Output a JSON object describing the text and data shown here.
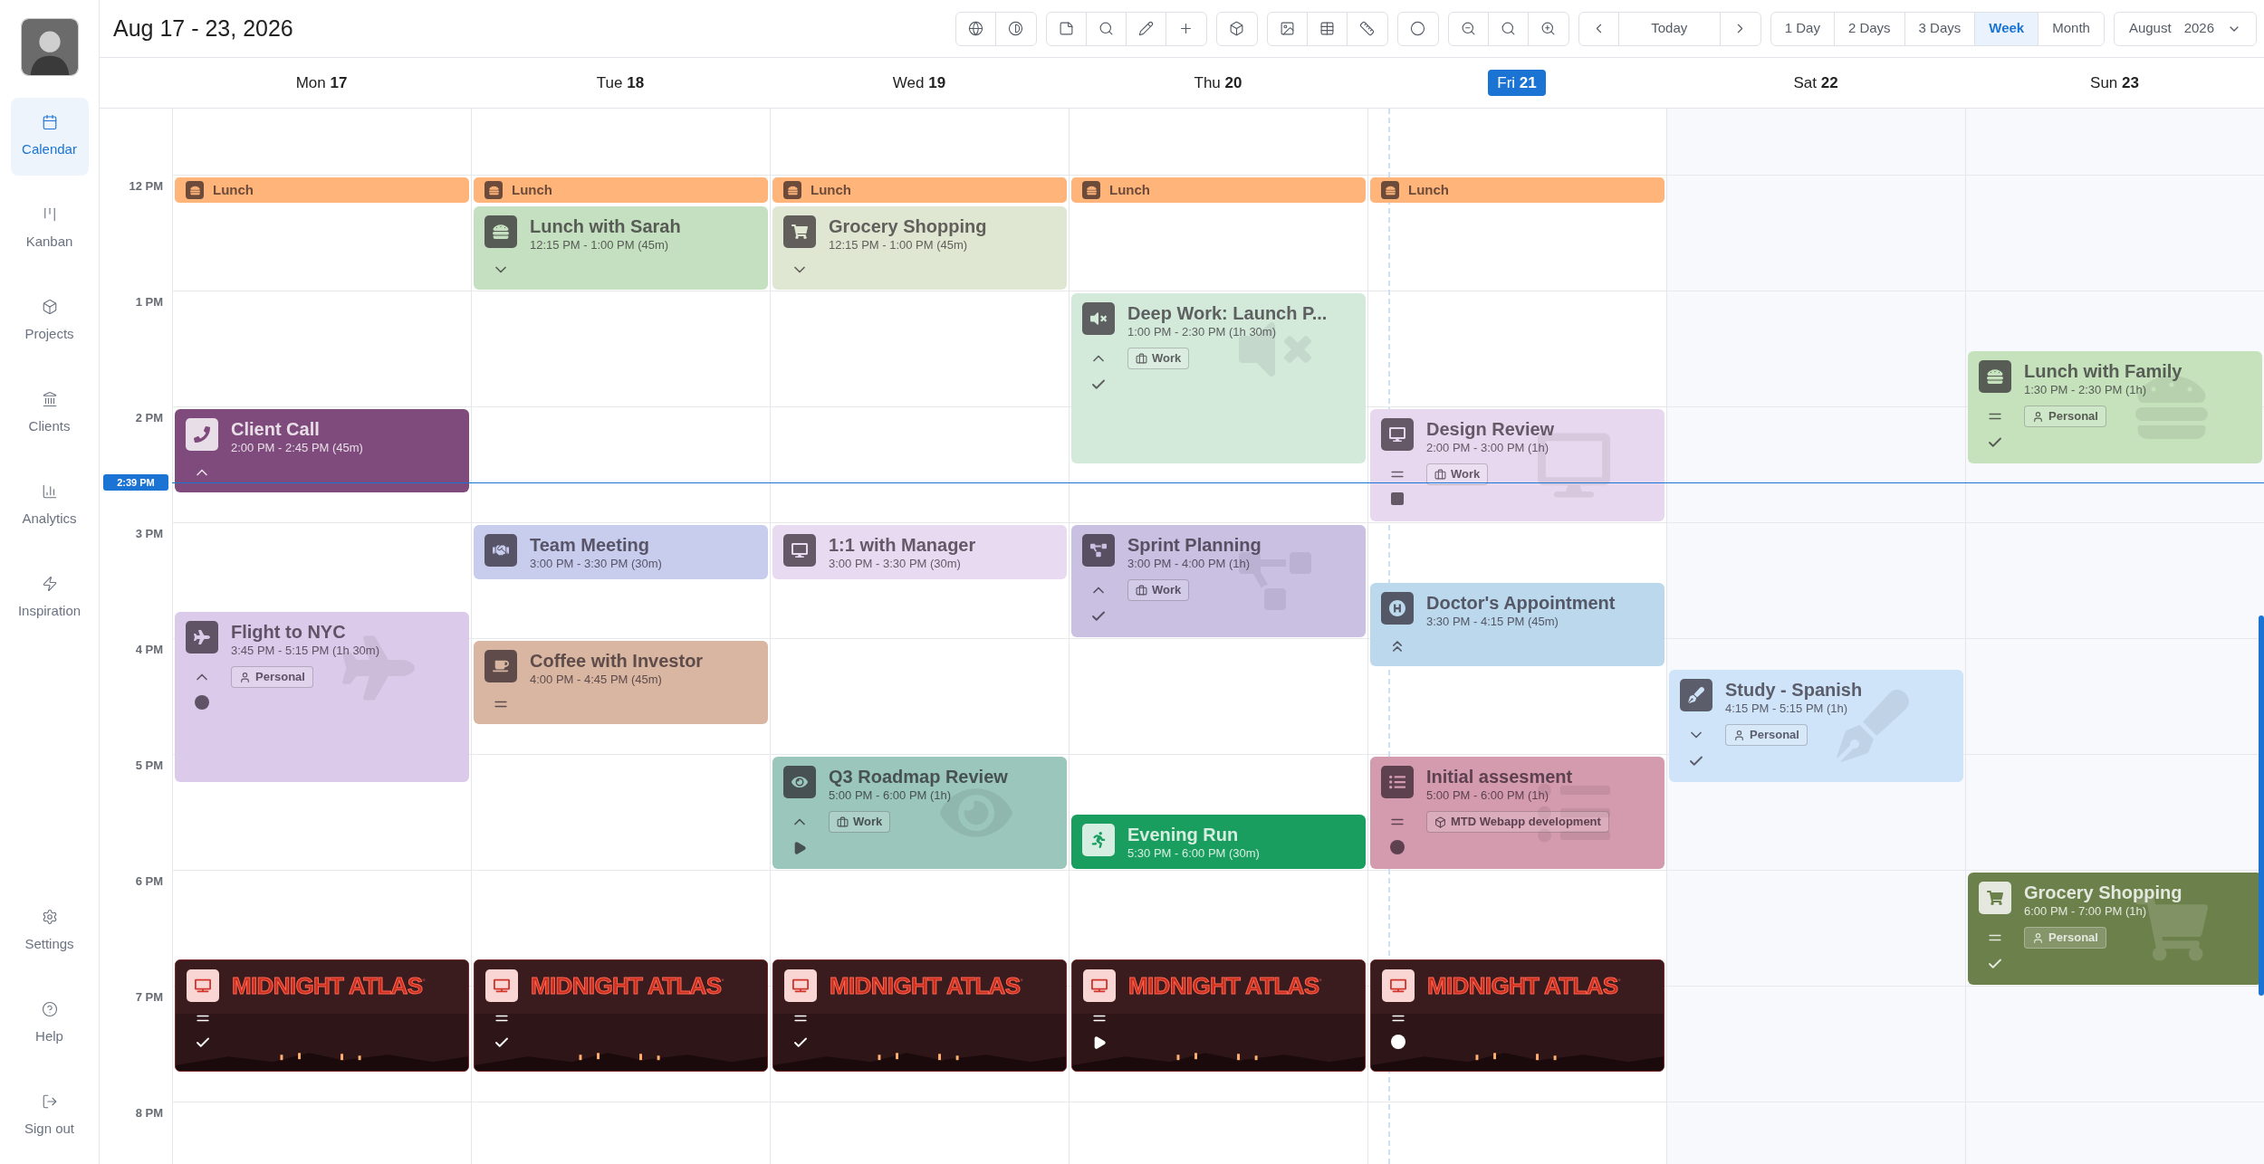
{
  "header": {
    "title": "Aug 17 - 23, 2026"
  },
  "toolbar": {
    "today": "Today",
    "views": [
      {
        "label": "1 Day",
        "selected": false
      },
      {
        "label": "2 Days",
        "selected": false
      },
      {
        "label": "3 Days",
        "selected": false
      },
      {
        "label": "Week",
        "selected": true
      },
      {
        "label": "Month",
        "selected": false
      }
    ],
    "month": "August",
    "year": "2026"
  },
  "sidebar": {
    "items": [
      {
        "label": "Calendar",
        "selected": true
      },
      {
        "label": "Kanban",
        "selected": false
      },
      {
        "label": "Projects",
        "selected": false
      },
      {
        "label": "Clients",
        "selected": false
      },
      {
        "label": "Analytics",
        "selected": false
      },
      {
        "label": "Inspiration",
        "selected": false
      }
    ],
    "bottom_items": [
      {
        "label": "Settings"
      },
      {
        "label": "Help"
      },
      {
        "label": "Sign out"
      }
    ]
  },
  "times": [
    "12 PM",
    "1 PM",
    "2 PM",
    "3 PM",
    "4 PM",
    "5 PM",
    "6 PM",
    "7 PM",
    "8 PM"
  ],
  "now": {
    "label": "2:39 PM"
  },
  "days": [
    {
      "weekday": "Mon",
      "date": "17",
      "today": false,
      "weekend": false,
      "events": [
        {
          "kind": "compact",
          "title": "Lunch",
          "color": "#ffb57a"
        },
        {
          "kind": "card",
          "title": "Client Call",
          "time": "2:00 PM - 2:45 PM (45m)",
          "color": "#7f4a7c",
          "priority": {
            "kind": "high"
          }
        },
        {
          "kind": "card",
          "title": "Flight to NYC",
          "time": "3:45 PM - 5:15 PM (1h 30m)",
          "color": "#dccaea",
          "priority": {
            "kind": "high"
          },
          "tag": {
            "kind": "personal",
            "label": "Personal"
          },
          "status": {
            "kind": "scheduled"
          }
        },
        {
          "kind": "banner",
          "title": "MIDNIGHT ATLAS",
          "color": "#3a1a1c",
          "priority": {
            "kind": "medium"
          },
          "status": {
            "kind": "done"
          }
        }
      ]
    },
    {
      "weekday": "Tue",
      "date": "18",
      "today": false,
      "weekend": false,
      "events": [
        {
          "kind": "compact",
          "title": "Lunch",
          "color": "#ffb57a"
        },
        {
          "kind": "card",
          "title": "Lunch with Sarah",
          "time": "12:15 PM - 1:00 PM (45m)",
          "color": "#c5e0c0",
          "priority": {
            "kind": "low"
          }
        },
        {
          "kind": "card",
          "title": "Team Meeting",
          "time": "3:00 PM - 3:30 PM (30m)",
          "color": "#c8cdee"
        },
        {
          "kind": "card",
          "title": "Coffee with Investor",
          "time": "4:00 PM - 4:45 PM (45m)",
          "color": "#d8b6a2",
          "priority": {
            "kind": "medium"
          }
        },
        {
          "kind": "banner",
          "title": "MIDNIGHT ATLAS",
          "color": "#3a1a1c",
          "priority": {
            "kind": "medium"
          },
          "status": {
            "kind": "done"
          }
        }
      ]
    },
    {
      "weekday": "Wed",
      "date": "19",
      "today": false,
      "weekend": false,
      "events": [
        {
          "kind": "compact",
          "title": "Lunch",
          "color": "#ffb57a"
        },
        {
          "kind": "card",
          "title": "Grocery Shopping",
          "time": "12:15 PM - 1:00 PM (45m)",
          "color": "#dfe7d2",
          "priority": {
            "kind": "low"
          }
        },
        {
          "kind": "card",
          "title": "1:1 with Manager",
          "time": "3:00 PM - 3:30 PM (30m)",
          "color": "#e8daf0"
        },
        {
          "kind": "card",
          "title": "Q3 Roadmap Review",
          "time": "5:00 PM - 6:00 PM (1h)",
          "color": "#9bc6bb",
          "priority": {
            "kind": "high"
          },
          "tag": {
            "kind": "work",
            "label": "Work"
          },
          "status": {
            "kind": "running"
          }
        },
        {
          "kind": "banner",
          "title": "MIDNIGHT ATLAS",
          "color": "#3a1a1c",
          "priority": {
            "kind": "medium"
          },
          "status": {
            "kind": "done"
          }
        }
      ]
    },
    {
      "weekday": "Thu",
      "date": "20",
      "today": false,
      "weekend": false,
      "events": [
        {
          "kind": "compact",
          "title": "Lunch",
          "color": "#ffb57a"
        },
        {
          "kind": "card",
          "title": "Deep Work: Launch P...",
          "time": "1:00 PM - 2:30 PM (1h 30m)",
          "color": "#d3eadb",
          "priority": {
            "kind": "high"
          },
          "tag": {
            "kind": "work",
            "label": "Work"
          },
          "status": {
            "kind": "done"
          }
        },
        {
          "kind": "card",
          "title": "Sprint Planning",
          "time": "3:00 PM - 4:00 PM (1h)",
          "color": "#c9c0e2",
          "priority": {
            "kind": "high"
          },
          "tag": {
            "kind": "work",
            "label": "Work"
          },
          "status": {
            "kind": "done"
          }
        },
        {
          "kind": "card",
          "title": "Evening Run",
          "time": "5:30 PM - 6:00 PM (30m)",
          "color": "#1a9e5f"
        },
        {
          "kind": "banner",
          "title": "MIDNIGHT ATLAS",
          "color": "#3a1a1c",
          "priority": {
            "kind": "medium"
          },
          "status": {
            "kind": "running"
          }
        }
      ]
    },
    {
      "weekday": "Fri",
      "date": "21",
      "today": true,
      "weekend": false,
      "events": [
        {
          "kind": "compact",
          "title": "Lunch",
          "color": "#ffb57a"
        },
        {
          "kind": "card",
          "title": "Design Review",
          "time": "2:00 PM - 3:00 PM (1h)",
          "color": "#e8d8ef",
          "priority": {
            "kind": "medium"
          },
          "tag": {
            "kind": "work",
            "label": "Work"
          },
          "status": {
            "kind": "stopped"
          }
        },
        {
          "kind": "card",
          "title": "Doctor's Appointment",
          "time": "3:30 PM - 4:15 PM (45m)",
          "color": "#bcd8ec",
          "priority": {
            "kind": "urgent"
          }
        },
        {
          "kind": "card",
          "title": "Initial assesment",
          "time": "5:00 PM - 6:00 PM (1h)",
          "color": "#d49bae",
          "priority": {
            "kind": "medium"
          },
          "tag": {
            "kind": "project",
            "label": "MTD Webapp development"
          },
          "status": {
            "kind": "scheduled"
          }
        },
        {
          "kind": "banner",
          "title": "MIDNIGHT ATLAS",
          "color": "#3a1a1c",
          "priority": {
            "kind": "medium"
          },
          "status": {
            "kind": "scheduled"
          }
        }
      ]
    },
    {
      "weekday": "Sat",
      "date": "22",
      "today": false,
      "weekend": true,
      "events": [
        {
          "kind": "card",
          "title": "Study - Spanish",
          "time": "4:15 PM - 5:15 PM (1h)",
          "color": "#cfe4f8",
          "priority": {
            "kind": "low"
          },
          "tag": {
            "kind": "personal",
            "label": "Personal"
          },
          "status": {
            "kind": "done"
          }
        }
      ]
    },
    {
      "weekday": "Sun",
      "date": "23",
      "today": false,
      "weekend": true,
      "events": [
        {
          "kind": "card",
          "title": "Lunch with Family",
          "time": "1:30 PM - 2:30 PM (1h)",
          "color": "#c5e2bd",
          "priority": {
            "kind": "medium"
          },
          "tag": {
            "kind": "personal",
            "label": "Personal"
          },
          "status": {
            "kind": "done"
          }
        },
        {
          "kind": "card",
          "title": "Grocery Shopping",
          "time": "6:00 PM - 7:00 PM (1h)",
          "color": "#6b804a",
          "priority": {
            "kind": "medium"
          },
          "tag": {
            "kind": "personal",
            "label": "Personal"
          },
          "status": {
            "kind": "done"
          }
        }
      ]
    }
  ]
}
